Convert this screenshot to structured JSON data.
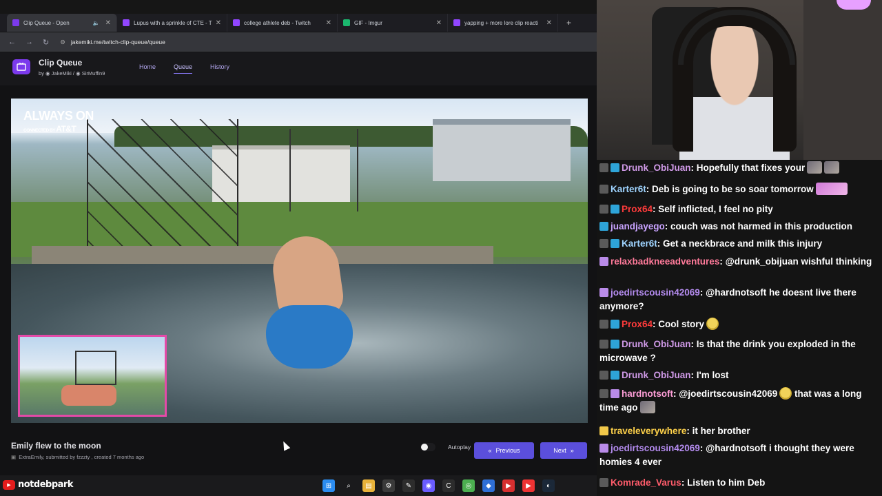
{
  "browser": {
    "tabs": [
      {
        "title": "Clip Queue - Open",
        "active": true,
        "color": "#7c3aed"
      },
      {
        "title": "Lupus with a sprinkle of CTE - T",
        "color": "#9146ff"
      },
      {
        "title": "college athlete deb - Twitch",
        "color": "#9146ff"
      },
      {
        "title": "GIF - Imgur",
        "color": "#1bb76e"
      },
      {
        "title": "yapping + more lore clip reacti",
        "color": "#9146ff"
      }
    ],
    "url": "jakemiki.me/twitch-clip-queue/queue"
  },
  "app": {
    "title": "Clip Queue",
    "by_prefix": "by",
    "author1": "JakeMiki",
    "author2": "SirMuffin9",
    "nav": [
      "Home",
      "Queue",
      "History"
    ]
  },
  "clip": {
    "watermark_top": "ALWAYS ON",
    "watermark_sub": "CONNECTED BY",
    "watermark_brand": "AT&T",
    "title": "Emily flew to the moon",
    "channel": "ExtraEmily",
    "meta_rest": ", submitted by fzzzty , created 7 months ago"
  },
  "controls": {
    "autoplay_label": "Autoplay",
    "autoplay_on": false,
    "previous_label": "Previous",
    "next_label": "Next"
  },
  "stream": {
    "channel_name": "notdebpark"
  },
  "chat": [
    {
      "user": "Drunk_ObiJuan",
      "color": "#d09ae8",
      "badges": [
        "mod",
        "prime"
      ],
      "text": "Hopefully that fixes your",
      "emotes": [
        "photo",
        "photo"
      ]
    },
    {
      "user": "Karter6t",
      "color": "#9fd4ff",
      "badges": [
        "mod"
      ],
      "text": "Deb is going to be so soar tomorrow",
      "emotes": [
        "pink"
      ]
    },
    {
      "user": "Prox64",
      "color": "#ff3b3b",
      "badges": [
        "mod",
        "prime"
      ],
      "text": "Self inflicted, I feel no pity"
    },
    {
      "user": "juandjayego",
      "color": "#c9a3ff",
      "badges": [
        "prime"
      ],
      "text": "couch was not harmed in this production"
    },
    {
      "user": "Karter6t",
      "color": "#9fd4ff",
      "badges": [
        "mod",
        "prime"
      ],
      "text": "Get a neckbrace and milk this injury"
    },
    {
      "user": "relaxbadkneeadventures",
      "color": "#ff7a9a",
      "badges": [
        "sub"
      ],
      "text": "@drunk_obijuan wishful thinking"
    },
    {
      "user": "joedirtscousin42069",
      "color": "#b58cf0",
      "badges": [
        "sub"
      ],
      "text": "@hardnotsoft he doesnt live there anymore?"
    },
    {
      "user": "Prox64",
      "color": "#ff3b3b",
      "badges": [
        "mod",
        "prime"
      ],
      "text": "Cool story",
      "emotes": [
        "face"
      ]
    },
    {
      "user": "Drunk_ObiJuan",
      "color": "#d09ae8",
      "badges": [
        "mod",
        "prime"
      ],
      "text": "Is that the drink you exploded in the microwave ?"
    },
    {
      "user": "Drunk_ObiJuan",
      "color": "#d09ae8",
      "badges": [
        "mod",
        "prime"
      ],
      "text": "I'm lost"
    },
    {
      "user": "hardnotsoft",
      "color": "#ff9ed8",
      "badges": [
        "mod",
        "sub"
      ],
      "text": "@joedirtscousin42069",
      "text2": "that was a long time ago",
      "emotes": [
        "face"
      ]
    },
    {
      "user": "traveleverywhere",
      "color": "#ffd24a",
      "badges": [
        "bits"
      ],
      "text": "it her brother"
    },
    {
      "user": "joedirtscousin42069",
      "color": "#b58cf0",
      "badges": [
        "sub"
      ],
      "text": "@hardnotsoft i thought they were homies 4 ever"
    },
    {
      "user": "Komrade_Varus",
      "color": "#ff5c6b",
      "badges": [
        "mod"
      ],
      "text": "Listen to him Deb"
    }
  ]
}
